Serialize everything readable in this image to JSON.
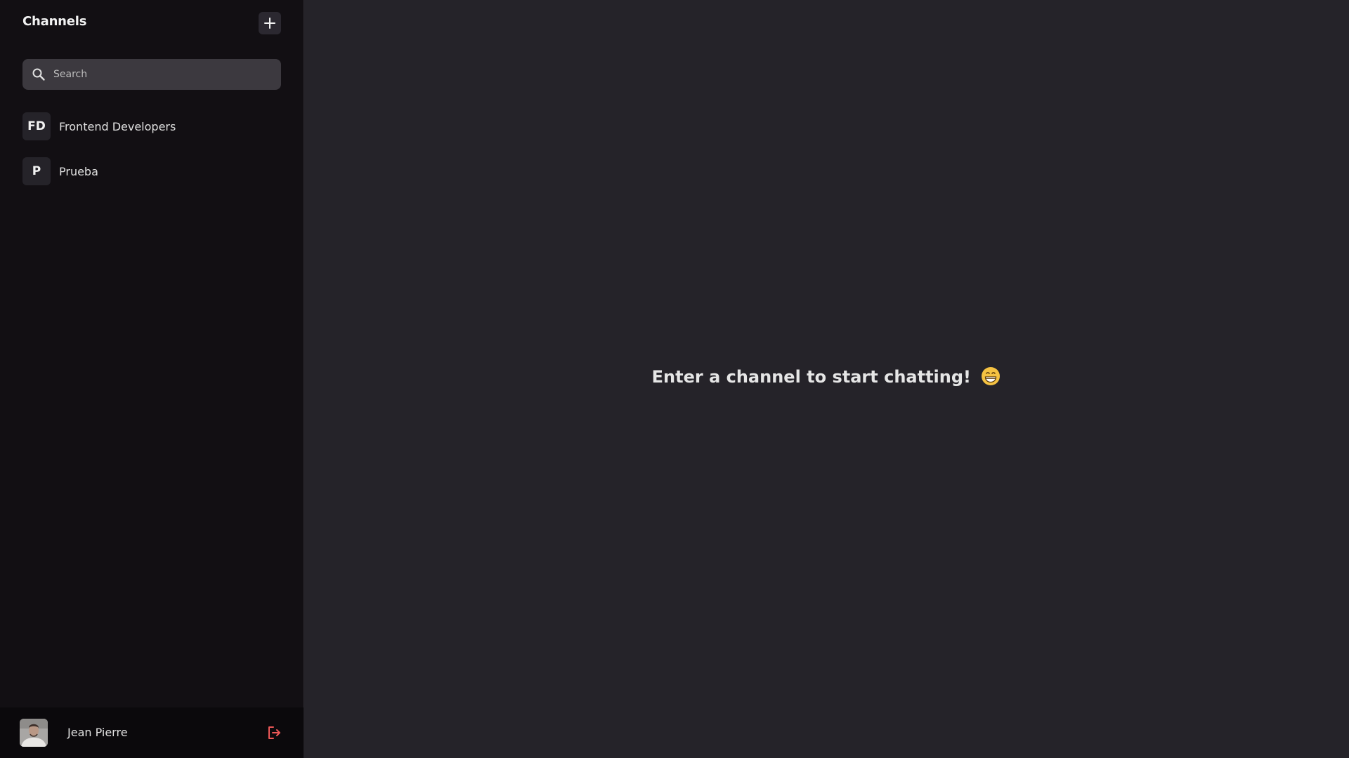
{
  "sidebar": {
    "title": "Channels",
    "add_icon": "plus-icon",
    "search": {
      "placeholder": "Search",
      "value": "",
      "icon": "search-icon"
    },
    "channels": [
      {
        "initials": "FD",
        "name": "Frontend Developers"
      },
      {
        "initials": "P",
        "name": "Prueba"
      }
    ]
  },
  "user": {
    "name": "Jean Pierre",
    "avatar": "user-avatar-photo",
    "logout_icon": "logout-icon",
    "logout_color": "#eb5757"
  },
  "main": {
    "empty_message": "Enter a channel to start chatting!",
    "emoji": "grinning-face-emoji"
  },
  "colors": {
    "sidebar_bg": "#120f13",
    "main_bg": "#252329",
    "search_bg": "#3c393f",
    "footer_bg": "#0b090c"
  }
}
